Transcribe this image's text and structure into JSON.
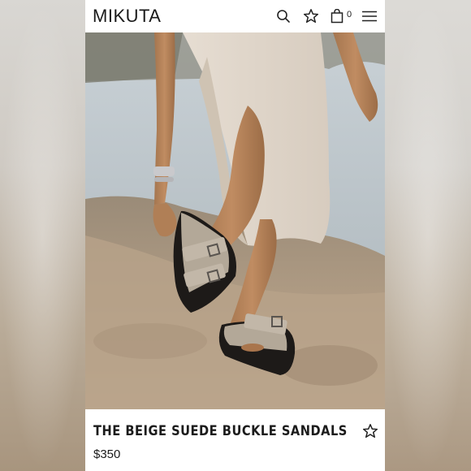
{
  "header": {
    "logo": "MIKUTA",
    "bag_count": "0",
    "icons": [
      "search-icon",
      "star-icon",
      "bag-icon",
      "menu-icon"
    ]
  },
  "product": {
    "title": "THE BEIGE SUEDE BUCKLE SANDALS",
    "price": "$350",
    "favorite_icon": "star-icon"
  },
  "colors": {
    "text": "#1b1b1b",
    "background": "#ffffff"
  }
}
